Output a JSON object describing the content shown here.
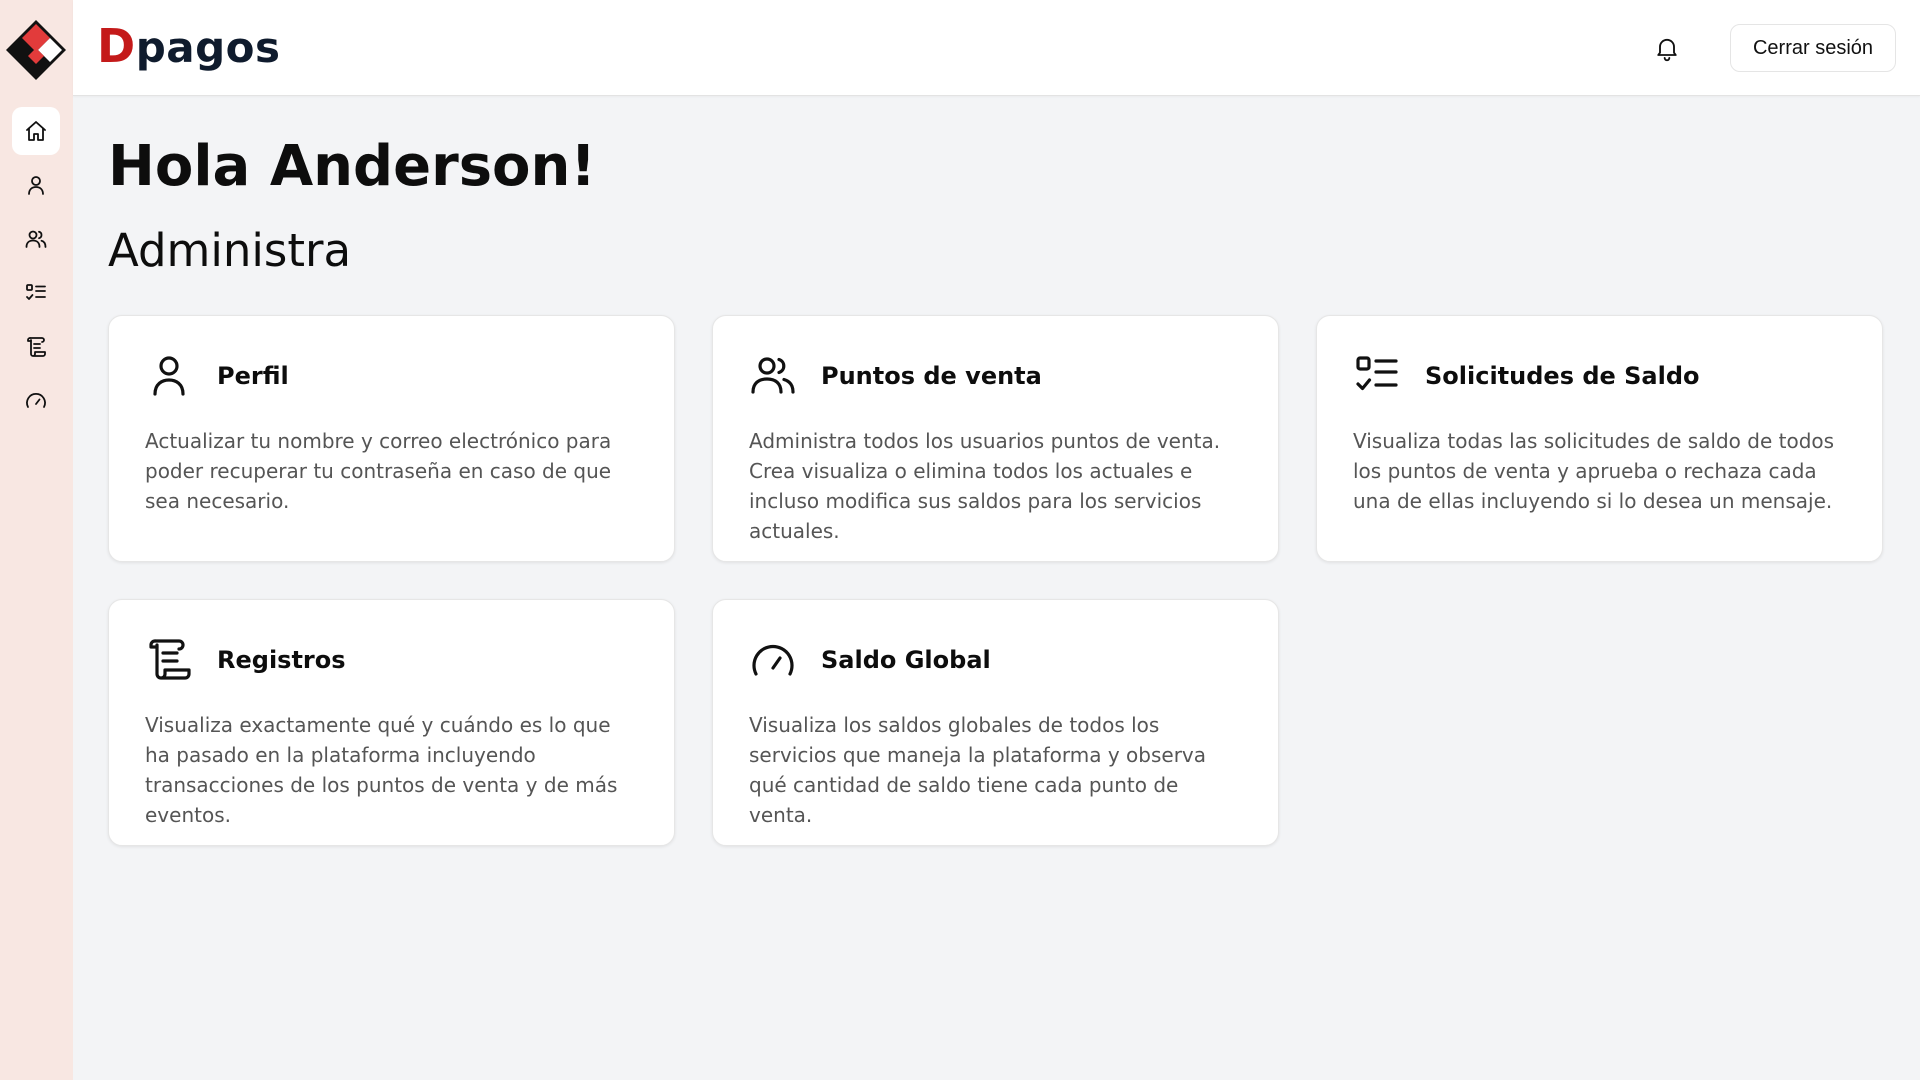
{
  "brand": {
    "first_letter": "D",
    "rest": "pagos",
    "accent": "#c41a1a",
    "dark": "#0f1b2d"
  },
  "sidebar": {
    "items": [
      {
        "icon": "home-icon",
        "active": true
      },
      {
        "icon": "user-icon",
        "active": false
      },
      {
        "icon": "users-icon",
        "active": false
      },
      {
        "icon": "checklist-icon",
        "active": false
      },
      {
        "icon": "scroll-icon",
        "active": false
      },
      {
        "icon": "gauge-icon",
        "active": false
      }
    ]
  },
  "header": {
    "notification_icon": "bell-icon",
    "logout_label": "Cerrar sesión"
  },
  "main": {
    "greeting": "Hola Anderson!",
    "section_title": "Administra",
    "cards": [
      {
        "icon": "user-icon",
        "title": "Perfil",
        "description": "Actualizar tu nombre y correo electrónico para poder recuperar tu contraseña en caso de que sea necesario."
      },
      {
        "icon": "users-icon",
        "title": "Puntos de venta",
        "description": "Administra todos los usuarios puntos de venta. Crea visualiza o elimina todos los actuales e incluso modifica sus saldos para los servicios actuales."
      },
      {
        "icon": "checklist-icon",
        "title": "Solicitudes de Saldo",
        "description": "Visualiza todas las solicitudes de saldo de todos los puntos de venta y aprueba o rechaza cada una de ellas incluyendo si lo desea un mensaje."
      },
      {
        "icon": "scroll-icon",
        "title": "Registros",
        "description": "Visualiza exactamente qué y cuándo es lo que ha pasado en la plataforma incluyendo transacciones de los puntos de venta y de más eventos."
      },
      {
        "icon": "gauge-icon",
        "title": "Saldo Global",
        "description": "Visualiza los saldos globales de todos los servicios que maneja la plataforma y observa qué cantidad de saldo tiene cada punto de venta."
      }
    ]
  }
}
